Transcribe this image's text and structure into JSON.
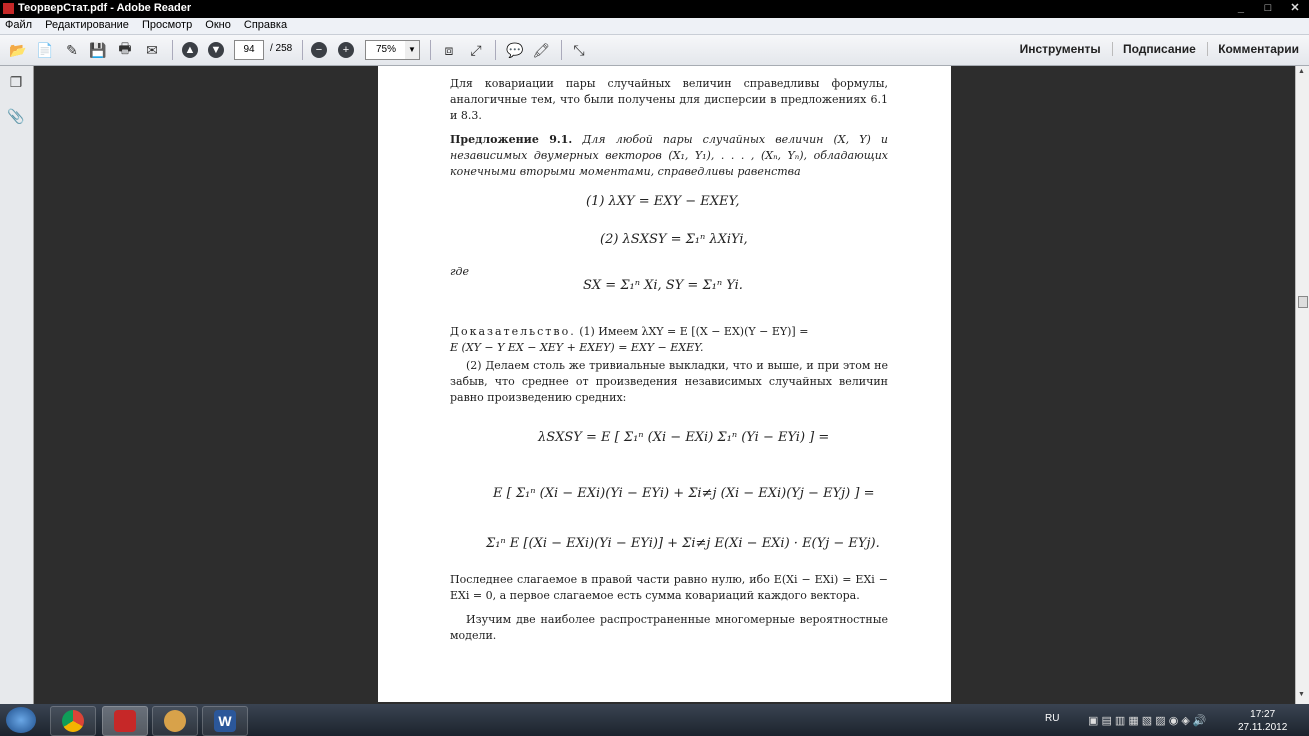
{
  "window": {
    "title": "ТеорверСтат.pdf - Adobe Reader",
    "controls": [
      "_",
      "□",
      "✕"
    ]
  },
  "menu": [
    "Файл",
    "Редактирование",
    "Просмотр",
    "Окно",
    "Справка"
  ],
  "toolbar": {
    "page_current": "94",
    "page_total": "/ 258",
    "zoom": "75%",
    "links": [
      "Инструменты",
      "Подписание",
      "Комментарии"
    ]
  },
  "doc": {
    "intro": "Для ковариации пары случайных величин справедливы формулы, аналогичные тем, что были получены для дисперсии в предложениях 6.1 и 8.3.",
    "prop_head": "Предложение 9.1.",
    "prop_text": "Для любой пары случайных величин (X, Y) и независимых двумерных векторов (X₁, Y₁), . . . , (Xₙ, Yₙ), обладающих конечными вторыми моментами, справедливы равенства",
    "eq1": "(1)   λXY = EXY − EXEY,",
    "eq2": "(2)   λSXSY = Σ₁ⁿ λXiYi,",
    "gde": "где",
    "eq3": "SX = Σ₁ⁿ Xi,    SY = Σ₁ⁿ Yi.",
    "proof_word": "Доказательство.",
    "proof_line1": "(1) Имеем λXY = E [(X − EX)(Y − EY)] =",
    "proof_line2": "E (XY − Y EX − XEY + EXEY) = EXY − EXEY.",
    "para2": "(2) Делаем столь же тривиальные выкладки, что и выше, и при этом не забыв, что среднее от произведения независимых случайных величин равно произведению средних:",
    "eq4": "λSXSY = E [ Σ₁ⁿ (Xi − EXi) Σ₁ⁿ (Yi − EYi) ] =",
    "eq5": "E [ Σ₁ⁿ (Xi − EXi)(Yi − EYi) + Σi≠j (Xi − EXi)(Yj − EYj) ] =",
    "eq6": "Σ₁ⁿ E [(Xi − EXi)(Yi − EYi)] + Σi≠j E(Xi − EXi) · E(Yj − EYj).",
    "para3": "Последнее слагаемое в правой части равно нулю, ибо E(Xi − EXi) = EXi − EXi = 0, а первое слагаемое есть сумма ковариаций каждого вектора.",
    "para4": "Изучим две наиболее распространенные многомерные вероятностные модели."
  },
  "taskbar": {
    "lang": "RU",
    "time": "17:27",
    "date": "27.11.2012"
  }
}
